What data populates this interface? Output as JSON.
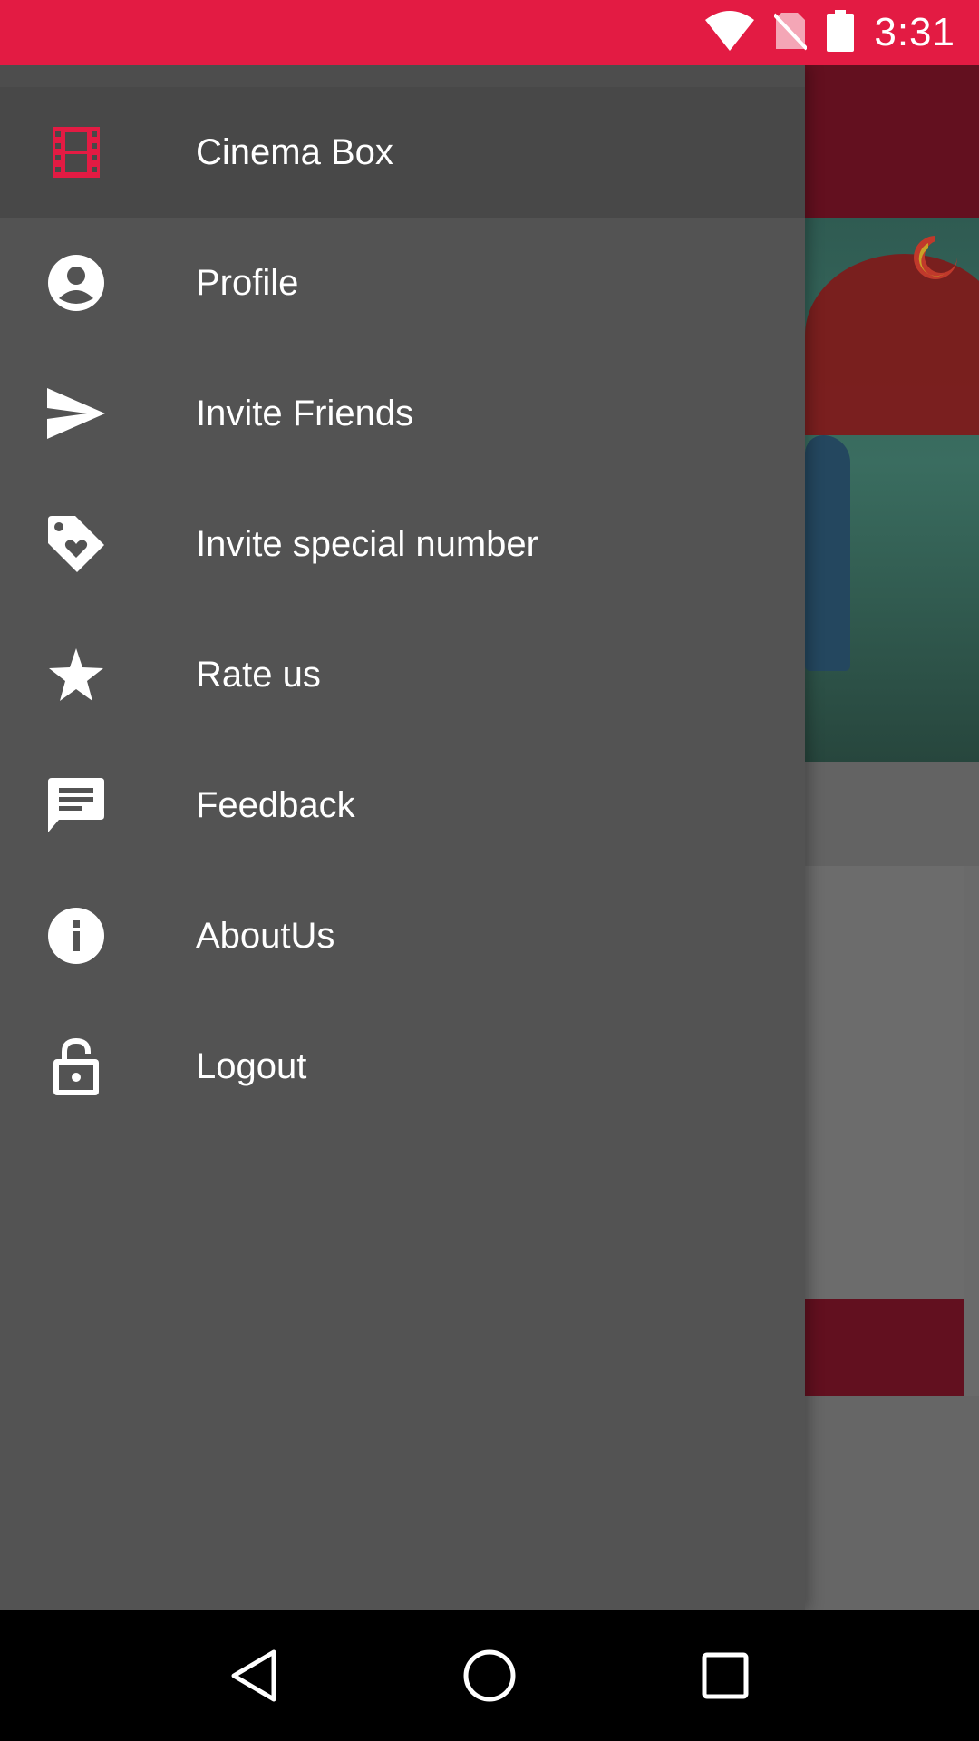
{
  "status_bar": {
    "time": "3:31",
    "background_color": "#e31b43",
    "icons": [
      "wifi-icon",
      "no-sim-icon",
      "battery-icon"
    ]
  },
  "drawer": {
    "accent_color": "#e31b43",
    "items": [
      {
        "label": "Cinema Box",
        "icon": "film-strip-icon",
        "active": true
      },
      {
        "label": "Profile",
        "icon": "account-circle-icon",
        "active": false
      },
      {
        "label": "Invite Friends",
        "icon": "send-icon",
        "active": false
      },
      {
        "label": "Invite special number",
        "icon": "heart-tag-icon",
        "active": false
      },
      {
        "label": "Rate us",
        "icon": "star-icon",
        "active": false
      },
      {
        "label": "Feedback",
        "icon": "message-icon",
        "active": false
      },
      {
        "label": "AboutUs",
        "icon": "info-icon",
        "active": false
      },
      {
        "label": "Logout",
        "icon": "lock-open-icon",
        "active": false
      }
    ]
  },
  "navigation_bar": {
    "buttons": [
      "back-icon",
      "home-icon",
      "recents-icon"
    ]
  }
}
